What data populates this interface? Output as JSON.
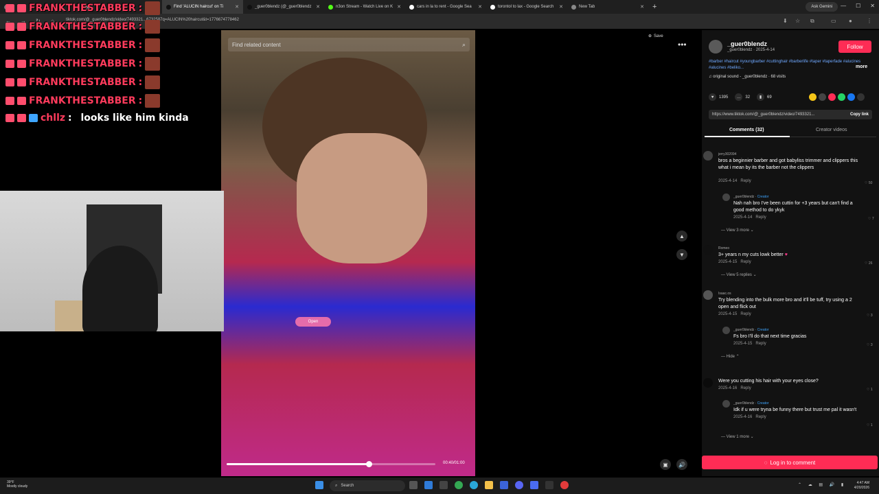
{
  "browser": {
    "tabs": [
      {
        "label": "",
        "active": false
      },
      {
        "label": "",
        "active": false
      },
      {
        "label": "Find 'ALUCIN haircut' on Ti",
        "active": true
      },
      {
        "label": "_guer0blendz (@_guer0blendz",
        "active": false
      },
      {
        "label": "n3on Stream - Watch Live on K",
        "active": false
      },
      {
        "label": "cars in la to rent - Google Sea",
        "active": false
      },
      {
        "label": "torontol to lax - Google Search",
        "active": false
      },
      {
        "label": "New Tab",
        "active": false
      }
    ],
    "new_tab": "+",
    "ask_gemini": "Ask Gemini",
    "url": "tiktok.com/@_guer0blendz/video/7493321...6732587q=ALUCIN%20haircut&t=1776674778462"
  },
  "chat": {
    "lines": [
      {
        "user": "FRANKTHESTABBER",
        "msg": ""
      },
      {
        "user": "FRANKTHESTABBER",
        "msg": ""
      },
      {
        "user": "FRANKTHESTABBER",
        "msg": ""
      },
      {
        "user": "FRANKTHESTABBER",
        "msg": ""
      },
      {
        "user": "FRANKTHESTABBER",
        "msg": ""
      },
      {
        "user": "FRANKTHESTABBER",
        "msg": ""
      },
      {
        "user": "chllz",
        "msg": "looks like him kinda"
      }
    ]
  },
  "video": {
    "search_placeholder": "Find related content",
    "open_pill": "Open",
    "time": "00:40/01:00",
    "progress": 0.68,
    "save_label": "Save",
    "more": "•••"
  },
  "post": {
    "username": "_guer0blendz",
    "handle_date": "_guer0blendz · 2025-4-14",
    "follow": "Follow",
    "description": "#barber #haircut #youngbarber #cuttinghair #barberlife #taper #taperfade #alucines #alucines #beliko...",
    "more": "more",
    "sound": "original sound - _guer0blendz · 68 visits",
    "likes": "1395",
    "comments": "32",
    "saves": "69",
    "link": "https://www.tiktok.com/@_guer0blendz/video/7493321...",
    "copy_link": "Copy link",
    "tab_comments": "Comments (32)",
    "tab_creator": "Creator videos",
    "login": "Log in to comment"
  },
  "comments": [
    {
      "user": "jerry302094",
      "text": "bros a beginnier barber and got babyliss trimmer and clippers this what i mean by its the barber not the clippers",
      "date": "2025-4-14",
      "reply": "Reply",
      "likes": "50"
    },
    {
      "user": "_guer0blendz",
      "creator": "Creator",
      "text": "Nah nah bro I've been cuttin for +3 years but can't find a good method to do ykyk",
      "date": "2025-4-14",
      "reply": "Reply",
      "likes": "7"
    },
    {
      "view": "View 3 more"
    },
    {
      "user": "Romeo",
      "text": "3+ years n my cuts lowk better",
      "date": "2025-4-15",
      "reply": "Reply",
      "likes": "26"
    },
    {
      "view": "View 5 replies"
    },
    {
      "user": "Isaac.os",
      "text": "Try blending into the bulk more bro and it'll be tuff, try using a 2 open and flick out",
      "date": "2025-4-15",
      "reply": "Reply",
      "likes": "3"
    },
    {
      "user": "_guer0blendz",
      "creator": "Creator",
      "text": "Fs bro I'll do that next time gracias",
      "date": "2025-4-15",
      "reply": "Reply",
      "likes": "3"
    },
    {
      "view": "Hide"
    },
    {
      "user": "",
      "text": "Were you cutting his hair with your eyes close?",
      "date": "2025-4-16",
      "reply": "Reply",
      "likes": "1"
    },
    {
      "user": "_guer0blendz",
      "creator": "Creator",
      "text": "Idk if u were tryna be funny there but trust me pal it wasn't",
      "date": "2025-4-16",
      "reply": "Reply",
      "likes": "1"
    },
    {
      "view": "View 1 more"
    }
  ],
  "taskbar": {
    "temp": "39°F",
    "weather": "Mostly cloudy",
    "search": "Search",
    "time": "4:47 AM",
    "date": "4/20/2026"
  }
}
